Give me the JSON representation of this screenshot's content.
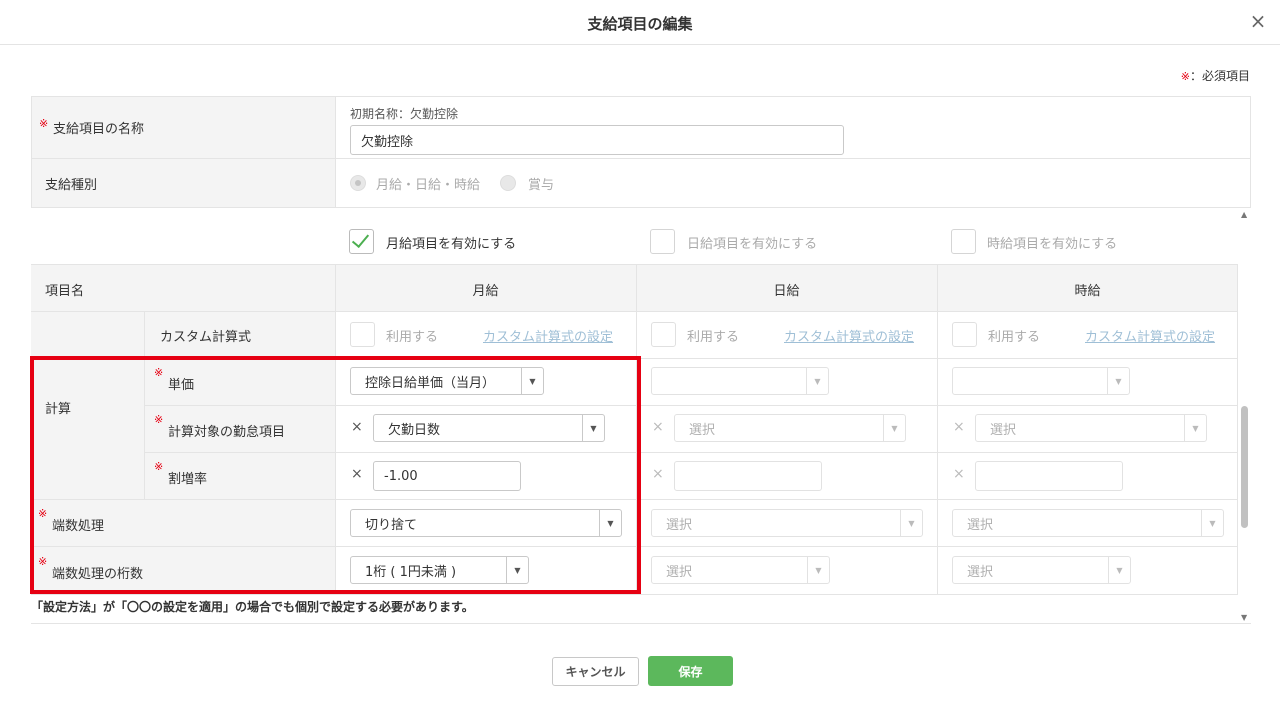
{
  "dialog": {
    "title": "支給項目の編集",
    "close_icon": "×"
  },
  "required_note": {
    "mark": "※",
    "text": "：必須項目"
  },
  "name_field": {
    "label": "支給項目の名称",
    "initial_name": "初期名称：欠勤控除",
    "value": "欠勤控除"
  },
  "pay_type": {
    "label": "支給種別",
    "options": [
      "月給・日給・時給",
      "賞与"
    ],
    "selected": "月給・日給・時給"
  },
  "enable_checks": [
    {
      "label": "月給項目を有効にする",
      "checked": true
    },
    {
      "label": "日給項目を有効にする",
      "checked": false
    },
    {
      "label": "時給項目を有効にする",
      "checked": false
    }
  ],
  "grid": {
    "headers": [
      "項目名",
      "月給",
      "日給",
      "時給"
    ],
    "custom_formula": {
      "label": "カスタム計算式",
      "use_label": "利用する",
      "link_label": "カスタム計算式の設定"
    },
    "calc": {
      "group_label": "計算",
      "unit_price": {
        "label": "単価",
        "monthly_value": "控除日給単価（当月）"
      },
      "attendance_item": {
        "label": "計算対象の勤怠項目",
        "monthly_value": "欠勤日数",
        "placeholder": "選択"
      },
      "rate": {
        "label": "割増率",
        "monthly_value": "-1.00"
      }
    },
    "rounding": {
      "label": "端数処理",
      "monthly_value": "切り捨て",
      "placeholder": "選択"
    },
    "rounding_digits": {
      "label": "端数処理の桁数",
      "monthly_value": "1桁 ( 1円未満 )",
      "placeholder": "選択"
    },
    "multiply_symbol": "×",
    "required_mark": "※"
  },
  "footnote": "「設定方法」が「〇〇の設定を適用」の場合でも個別で設定する必要があります。",
  "buttons": {
    "cancel": "キャンセル",
    "save": "保存"
  },
  "colors": {
    "accent_green": "#5cb85c",
    "required_red": "#e60012",
    "highlight_box": "#e60012"
  }
}
